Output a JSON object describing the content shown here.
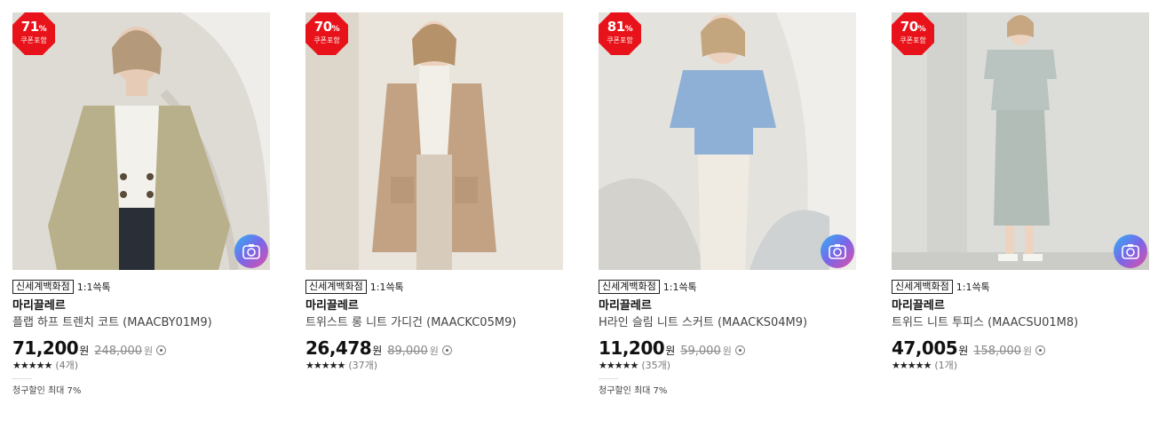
{
  "products": [
    {
      "discount_num": "71",
      "discount_unit": "%",
      "coupon_label": "쿠폰포함",
      "store": "신세계백화점",
      "chat": "1:1쓱톡",
      "brand": "마리끌레르",
      "name": "플랩 하프 트렌치 코트 (MAACBY01M9)",
      "price": "71,200",
      "price_unit": "원",
      "original_price": "248,000",
      "original_unit": "원",
      "stars": "★★★★★",
      "rating_count": "(4개)",
      "benefit": "청구할인 최대 7%"
    },
    {
      "discount_num": "70",
      "discount_unit": "%",
      "coupon_label": "쿠폰포함",
      "store": "신세계백화점",
      "chat": "1:1쓱톡",
      "brand": "마리끌레르",
      "name": "트위스트 롱 니트 가디건 (MAACKC05M9)",
      "price": "26,478",
      "price_unit": "원",
      "original_price": "89,000",
      "original_unit": "원",
      "stars": "★★★★★",
      "rating_count": "(37개)",
      "benefit": ""
    },
    {
      "discount_num": "81",
      "discount_unit": "%",
      "coupon_label": "쿠폰포함",
      "store": "신세계백화점",
      "chat": "1:1쓱톡",
      "brand": "마리끌레르",
      "name": "H라인 슬림 니트 스커트 (MAACKS04M9)",
      "price": "11,200",
      "price_unit": "원",
      "original_price": "59,000",
      "original_unit": "원",
      "stars": "★★★★★",
      "rating_count": "(35개)",
      "benefit": "청구할인 최대 7%"
    },
    {
      "discount_num": "70",
      "discount_unit": "%",
      "coupon_label": "쿠폰포함",
      "store": "신세계백화점",
      "chat": "1:1쓱톡",
      "brand": "마리끌레르",
      "name": "트위드 니트 투피스 (MAACSU01M8)",
      "price": "47,005",
      "price_unit": "원",
      "original_price": "158,000",
      "original_unit": "원",
      "stars": "★★★★★",
      "rating_count": "(1개)",
      "benefit": ""
    }
  ],
  "colors": {
    "badge": "#e8131a",
    "photo_bg_1": "#dedbd4",
    "photo_bg_2": "#e9e4dc",
    "photo_bg_3": "#e4e2dd",
    "photo_bg_4": "#dcdcd8"
  }
}
